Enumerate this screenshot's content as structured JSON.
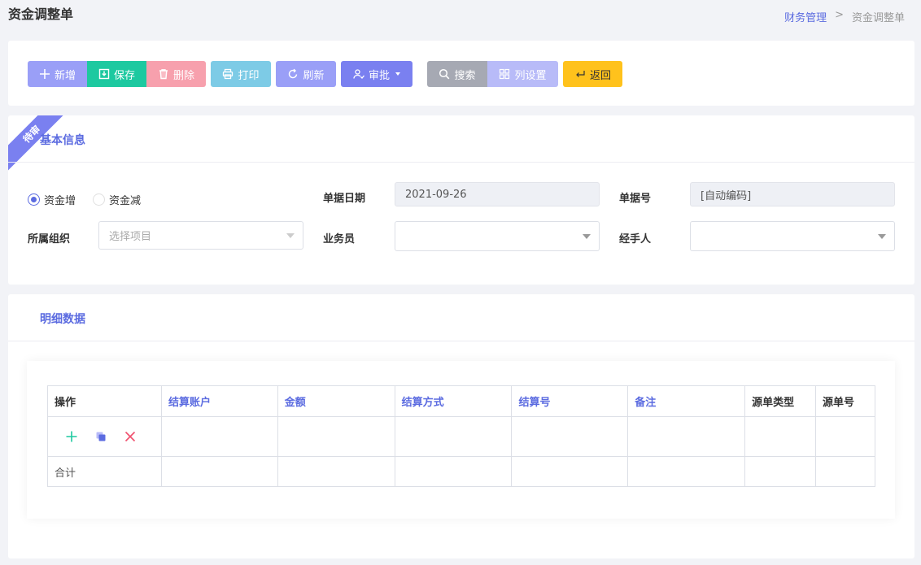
{
  "header": {
    "title": "资金调整单",
    "breadcrumb": {
      "parent": "财务管理",
      "separator": ">",
      "current": "资金调整单"
    }
  },
  "toolbar": {
    "add": "新增",
    "save": "保存",
    "delete": "删除",
    "print": "打印",
    "refresh": "刷新",
    "approve": "审批",
    "search": "搜索",
    "columns": "列设置",
    "back": "返回"
  },
  "status_ribbon": "待审",
  "basic_info": {
    "title": "基本信息",
    "radio_increase": "资金增",
    "radio_decrease": "资金减",
    "selected": "资金增",
    "date_label": "单据日期",
    "date_value": "2021-09-26",
    "doc_no_label": "单据号",
    "doc_no_value": "[自动编码]",
    "org_label": "所属组织",
    "org_placeholder": "选择项目",
    "salesman_label": "业务员",
    "salesman_value": "",
    "handler_label": "经手人",
    "handler_value": ""
  },
  "detail": {
    "title": "明细数据",
    "columns": [
      "操作",
      "结算账户",
      "金额",
      "结算方式",
      "结算号",
      "备注",
      "源单类型",
      "源单号"
    ],
    "total_label": "合计"
  },
  "colors": {
    "accent": "#5b6be0",
    "save": "#1dc9a0",
    "delete": "#f7a0ad",
    "back": "#ffc21c"
  }
}
